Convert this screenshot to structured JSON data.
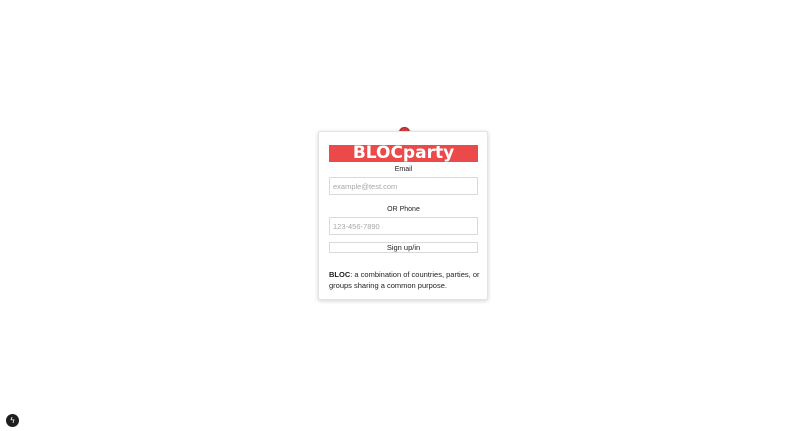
{
  "brand": {
    "title": "BLOCparty",
    "accent": "#ec4a4a",
    "pin_color": "#d43d3d"
  },
  "form": {
    "email_label": "Email",
    "email_placeholder": "example@test.com",
    "phone_label": "OR Phone",
    "phone_placeholder": "123-456-7890",
    "submit_label": "Sign up/in"
  },
  "definition": {
    "term": "BLOC",
    "text": ": a combination of countries, parties, or groups sharing a common purpose."
  },
  "corner_icon": {
    "name": "bolt-icon",
    "glyph": "ϟ"
  }
}
